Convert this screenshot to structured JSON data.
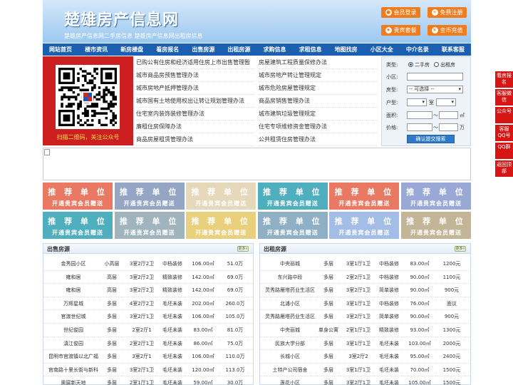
{
  "header": {
    "title": "楚雄房产信息网",
    "subtitle": "楚雄房产信息网二手房信息    楚雄房产信息网出租房信息",
    "buttons": [
      {
        "label": "会员登录",
        "icon": "user-icon"
      },
      {
        "label": "免费注册",
        "icon": "register-icon"
      },
      {
        "label": "贵宾套餐",
        "icon": "vip-icon"
      },
      {
        "label": "金币充值",
        "icon": "coin-icon"
      }
    ]
  },
  "nav": [
    "网站首页",
    "楼市资讯",
    "新房楼盘",
    "看房报名",
    "出售房源",
    "出租房源",
    "求购信息",
    "求租信息",
    "地图找房",
    "小区大全",
    "中介名录",
    "联系客服"
  ],
  "qr": {
    "caption": "扫描二维码，关注公众号"
  },
  "news": {
    "left": [
      "已购公有住房和经济适用住房上市出售管理暂",
      "城市商品房预售管理办法",
      "城市房地产抵押管理办法",
      "城市国有土地使用权出让转让规划管理办法",
      "住宅室内装饰装修管理办法",
      "廉租住房保障办法",
      "商品房屋租赁管理办法"
    ],
    "right": [
      "房屋建筑工程质量保修办法",
      "城市房地产转让管理规定",
      "城市危险房屋管理规定",
      "商品房销售管理办法",
      "城市建筑垃圾管理规定",
      "住宅专项维修资金管理办法",
      "公共租赁住房管理办法"
    ]
  },
  "search": {
    "type_label": "类型:",
    "type_options": [
      "二手房",
      "出租房"
    ],
    "community_label": "小区:",
    "house_type_label": "房型:",
    "house_type_value": "-- 可选择 --",
    "layout_label": "户型:",
    "room_unit": "室",
    "area_label": "面积:",
    "area_unit": "㎡",
    "price_label": "价格:",
    "price_unit": "万",
    "range_sep": "～",
    "submit": "确认提交搜索"
  },
  "ads": {
    "title": "推 荐 单 位",
    "subtitle": "开通贵宾会员赠送",
    "colors": [
      "#e97963",
      "#94a6c4",
      "#e6d8ba",
      "#4fafbe",
      "#e97963",
      "#9aa8d6",
      "#4fafbe",
      "#9fb4bd",
      "#e9d07d",
      "#8fb0c4",
      "#a3bde7",
      "#c3b597"
    ]
  },
  "sale": {
    "title": "出售房源",
    "more": "更多»",
    "rows": [
      [
        "金秀园小区",
        "小高层",
        "3室2厅2卫",
        "中档装修",
        "106.00㎡",
        "51.0万"
      ],
      [
        "雍和居",
        "高层",
        "3室2厅2卫",
        "精致装修",
        "142.00㎡",
        "69.0万"
      ],
      [
        "雍和居",
        "高层",
        "3室2厅2卫",
        "精致装修",
        "142.00㎡",
        "69.0万"
      ],
      [
        "万辉星城",
        "多层",
        "4室2厅2卫",
        "毛坯未装",
        "202.00㎡",
        "260.0万"
      ],
      [
        "官渡世纪城",
        "多层",
        "3室2厅1卫",
        "毛坯未装",
        "106.00㎡",
        "105.0万"
      ],
      [
        "世纪俊园",
        "多层",
        "2室2厅1",
        "毛坯未装",
        "83.00㎡",
        "81.0万"
      ],
      [
        "滇江俊园",
        "多层",
        "2室2厅1卫",
        "毛坯未装",
        "86.00㎡",
        "75.0万"
      ],
      [
        "昆明市官渡镇以北广福",
        "多层",
        "3室2厅1",
        "毛坯未装",
        "106.00㎡",
        "110.0万"
      ],
      [
        "官南路十里长街与新科",
        "多层",
        "3室2厅1卫",
        "毛坯未装",
        "120.00㎡",
        "113.0万"
      ],
      [
        "奥宸新天地",
        "多层",
        "2室1厅1卫",
        "毛坯未装",
        "59.00㎡",
        "30.0万"
      ]
    ]
  },
  "rent": {
    "title": "出租房源",
    "more": "更多»",
    "rows": [
      [
        "中央丽城",
        "多层",
        "3室1厅1卫",
        "中档装修",
        "83.00㎡",
        "1200元"
      ],
      [
        "东兴路中段",
        "多层",
        "2室2厅1卫",
        "中档装修",
        "90.00㎡",
        "1100元"
      ],
      [
        "灵秀路雁塔药业生活区",
        "多层",
        "3室2厅1卫",
        "简单装修",
        "90.00㎡",
        "900元"
      ],
      [
        "北浦小区",
        "多层",
        "3室1厅1卫",
        "中档装修",
        "76.00㎡",
        "面议"
      ],
      [
        "灵秀路雁塔药业生活区",
        "多层",
        "3室2厅1卫",
        "简单装修",
        "90.00㎡",
        "900元"
      ],
      [
        "中央丽城",
        "单身公寓",
        "2室1厅1卫",
        "精致装修",
        "93.00㎡",
        "1300元"
      ],
      [
        "民族大学分部",
        "多层",
        "3室1厅1卫",
        "毛坯未装",
        "103.00㎡",
        "2000元"
      ],
      [
        "长城小区",
        "多层",
        "3室2厅2",
        "毛坯未装",
        "95.00㎡",
        "2400元"
      ],
      [
        "土特产公司宿舍",
        "多层",
        "3室1厅1卫",
        "毛坯未装",
        "70.00㎡",
        "1500元"
      ],
      [
        "莲花小区",
        "多层",
        "3室2厅1卫",
        "毛坯未装",
        "105.00㎡",
        "1500元"
      ]
    ]
  },
  "float_bar": [
    "看房报名",
    "客服微信",
    "公众号",
    "客服QQ号",
    "QQ群",
    "返回顶部"
  ]
}
